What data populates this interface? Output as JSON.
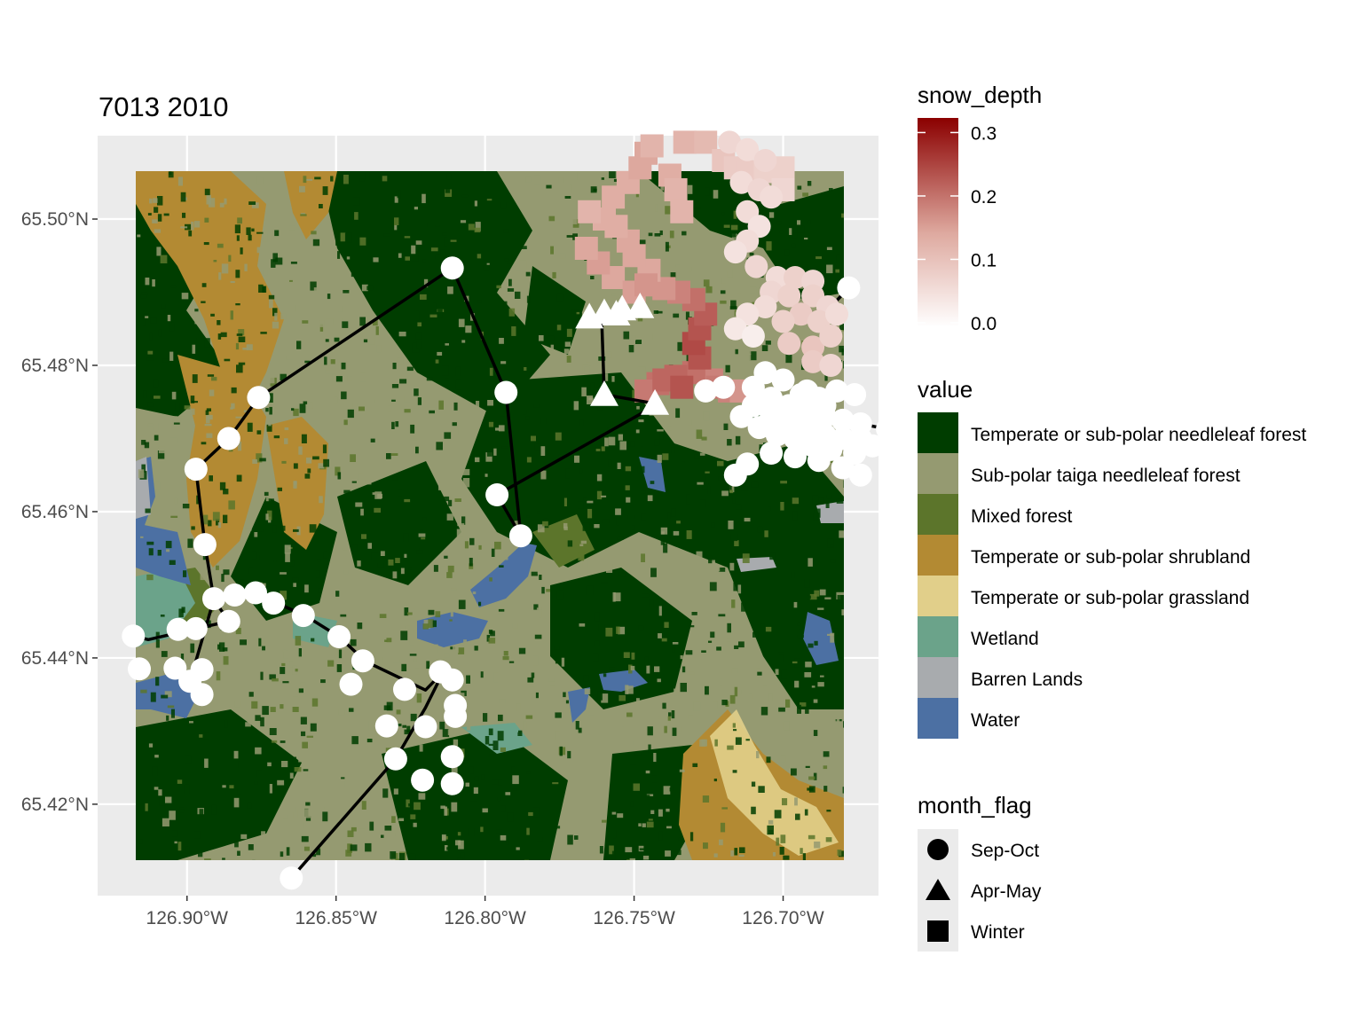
{
  "title": "7013 2010",
  "axes": {
    "x_ticks": [
      "126.90°W",
      "126.85°W",
      "126.80°W",
      "126.75°W",
      "126.70°W"
    ],
    "y_ticks": [
      "65.50°N",
      "65.48°N",
      "65.46°N",
      "65.44°N",
      "65.42°N"
    ]
  },
  "legend_snow": {
    "title": "snow_depth",
    "ticks": [
      "0.3",
      "0.2",
      "0.1",
      "0.0"
    ],
    "colors": {
      "low": "#ffffff",
      "mid": "#d49a8f",
      "high": "#8b0000"
    }
  },
  "legend_value": {
    "title": "value",
    "items": [
      {
        "label": "Temperate or sub-polar needleleaf forest",
        "color": "#003d00"
      },
      {
        "label": "Sub-polar taiga needleleaf forest",
        "color": "#959a71"
      },
      {
        "label": "Mixed forest",
        "color": "#5c752b"
      },
      {
        "label": "Temperate or sub-polar shrubland",
        "color": "#b38a33"
      },
      {
        "label": "Temperate or sub-polar grassland",
        "color": "#e1cf8a"
      },
      {
        "label": "Wetland",
        "color": "#6ba38a"
      },
      {
        "label": "Barren Lands",
        "color": "#a8abae"
      },
      {
        "label": "Water",
        "color": "#4c70a3"
      }
    ]
  },
  "legend_month": {
    "title": "month_flag",
    "items": [
      {
        "label": "Sep-Oct",
        "shape": "circle-icon"
      },
      {
        "label": "Apr-May",
        "shape": "triangle-icon"
      },
      {
        "label": "Winter",
        "shape": "square-icon"
      }
    ]
  },
  "chart_data": {
    "type": "scatter",
    "title": "7013 2010",
    "xlabel": "",
    "ylabel": "",
    "xlim": [
      -126.93,
      -126.668
    ],
    "ylim": [
      65.4075,
      65.5114
    ],
    "x_ticks": [
      -126.9,
      -126.85,
      -126.8,
      -126.75,
      -126.7
    ],
    "y_ticks": [
      65.5,
      65.48,
      65.46,
      65.44,
      65.42
    ],
    "track": [
      [
        -126.865,
        65.4099
      ],
      [
        -126.83,
        65.4262
      ],
      [
        -126.82,
        65.4332
      ],
      [
        -126.814,
        65.4381
      ],
      [
        -126.82,
        65.4356
      ],
      [
        -126.84,
        65.4395
      ],
      [
        -126.849,
        65.4429
      ],
      [
        -126.86,
        65.4457
      ],
      [
        -126.871,
        65.4477
      ],
      [
        -126.88,
        65.4492
      ],
      [
        -126.886,
        65.4488
      ],
      [
        -126.891,
        65.448
      ],
      [
        -126.894,
        65.4555
      ],
      [
        -126.897,
        65.4658
      ],
      [
        -126.886,
        65.47
      ],
      [
        -126.876,
        65.4756
      ],
      [
        -126.811,
        65.4933
      ],
      [
        -126.793,
        65.4763
      ],
      [
        -126.788,
        65.4567
      ],
      [
        -126.796,
        65.4623
      ],
      [
        -126.742,
        65.4747
      ],
      [
        -126.76,
        65.476
      ],
      [
        -126.761,
        65.488
      ]
    ],
    "track2": [
      [
        -126.891,
        65.448
      ],
      [
        -126.886,
        65.445
      ],
      [
        -126.897,
        65.444
      ],
      [
        -126.913,
        65.4425
      ],
      [
        -126.918,
        65.443
      ]
    ],
    "points_sepoct_white": [
      [
        -126.865,
        65.4099
      ],
      [
        -126.83,
        65.4262
      ],
      [
        -126.821,
        65.4233
      ],
      [
        -126.811,
        65.4228
      ],
      [
        -126.811,
        65.4265
      ],
      [
        -126.82,
        65.4306
      ],
      [
        -126.833,
        65.4307
      ],
      [
        -126.81,
        65.432
      ],
      [
        -126.81,
        65.4335
      ],
      [
        -126.827,
        65.4357
      ],
      [
        -126.845,
        65.4364
      ],
      [
        -126.811,
        65.437
      ],
      [
        -126.815,
        65.4381
      ],
      [
        -126.841,
        65.4396
      ],
      [
        -126.849,
        65.4429
      ],
      [
        -126.861,
        65.4458
      ],
      [
        -126.871,
        65.4475
      ],
      [
        -126.877,
        65.4489
      ],
      [
        -126.884,
        65.4486
      ],
      [
        -126.891,
        65.4481
      ],
      [
        -126.886,
        65.445
      ],
      [
        -126.897,
        65.444
      ],
      [
        -126.903,
        65.4439
      ],
      [
        -126.918,
        65.443
      ],
      [
        -126.916,
        65.4385
      ],
      [
        -126.904,
        65.4386
      ],
      [
        -126.895,
        65.4384
      ],
      [
        -126.899,
        65.4368
      ],
      [
        -126.895,
        65.435
      ],
      [
        -126.894,
        65.4555
      ],
      [
        -126.897,
        65.4658
      ],
      [
        -126.886,
        65.47
      ],
      [
        -126.876,
        65.4756
      ],
      [
        -126.811,
        65.4933
      ],
      [
        -126.793,
        65.4763
      ],
      [
        -126.788,
        65.4567
      ],
      [
        -126.796,
        65.4623
      ],
      [
        -126.678,
        65.4906
      ],
      [
        -126.665,
        65.4713
      ]
    ],
    "points_apr_may": [
      [
        -126.76,
        65.476
      ],
      [
        -126.765,
        65.4866
      ],
      [
        -126.76,
        65.4872
      ],
      [
        -126.754,
        65.4877
      ],
      [
        -126.748,
        65.488
      ],
      [
        -126.743,
        65.4748
      ],
      [
        -126.756,
        65.487
      ]
    ],
    "snow_depth_range": [
      0.0,
      0.33
    ],
    "legend_value": [
      "Temperate or sub-polar needleleaf forest",
      "Sub-polar taiga needleleaf forest",
      "Mixed forest",
      "Temperate or sub-polar shrubland",
      "Temperate or sub-polar grassland",
      "Wetland",
      "Barren Lands",
      "Water"
    ],
    "legend_month_flag": [
      "Sep-Oct",
      "Apr-May",
      "Winter"
    ],
    "grid": true,
    "legend_position": "right"
  }
}
